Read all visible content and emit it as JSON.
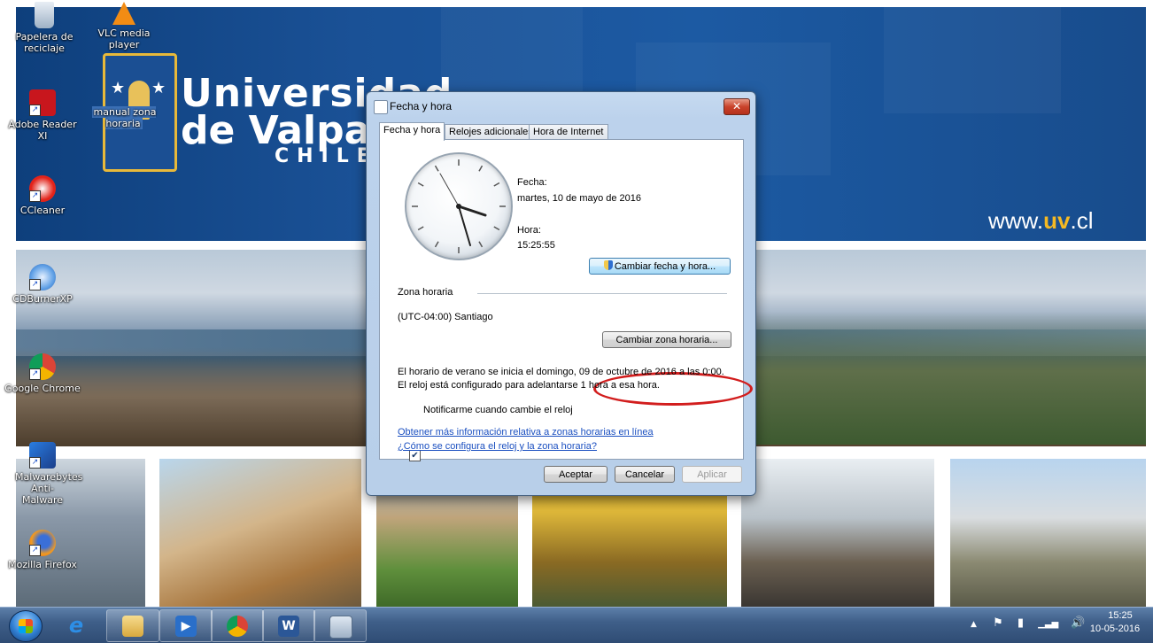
{
  "desktop": {
    "banner": {
      "line1": "Universidad",
      "line2": "de Valparaíso",
      "line3": "CHILE",
      "url_prefix": "www.",
      "url_brand": "uv",
      "url_suffix": ".cl"
    },
    "icons": [
      {
        "label": "Papelera de reciclaje",
        "icon": "recycle-bin-icon"
      },
      {
        "label": "VLC media player",
        "icon": "vlc-icon"
      },
      {
        "label": "Adobe Reader XI",
        "icon": "adobe-reader-icon"
      },
      {
        "label": "manual zona horaria",
        "icon": "document-icon"
      },
      {
        "label": "CCleaner",
        "icon": "ccleaner-icon"
      },
      {
        "label": "CDBurnerXP",
        "icon": "cdburner-icon"
      },
      {
        "label": "Google Chrome",
        "icon": "chrome-icon"
      },
      {
        "label": "Malwarebytes Anti-Malware",
        "icon": "malwarebytes-icon"
      },
      {
        "label": "Mozilla Firefox",
        "icon": "firefox-icon"
      }
    ]
  },
  "dialog": {
    "title": "Fecha y hora",
    "close": "✕",
    "tabs": [
      {
        "label": "Fecha y hora",
        "active": true
      },
      {
        "label": "Relojes adicionales",
        "active": false
      },
      {
        "label": "Hora de Internet",
        "active": false
      }
    ],
    "date_label": "Fecha:",
    "date_value": "martes, 10 de mayo de 2016",
    "time_label": "Hora:",
    "time_value": "15:25:55",
    "change_datetime_button": "Cambiar fecha y hora...",
    "timezone_heading": "Zona horaria",
    "timezone_value": "(UTC-04:00) Santiago",
    "change_timezone_button": "Cambiar zona horaria...",
    "dst_line1": "El horario de verano se inicia el domingo, 09 de octubre de 2016 a las 0:00.",
    "dst_line2": "El reloj está configurado para adelantarse 1 hora a esa hora.",
    "notify_checkbox": {
      "label": "Notificarme cuando cambie el reloj",
      "checked": true
    },
    "link_more_info": "Obtener más información relativa a zonas horarias en línea",
    "link_howto": "¿Cómo se configura el reloj y la zona horaria?",
    "ok_button": "Aceptar",
    "cancel_button": "Cancelar",
    "apply_button": "Aplicar"
  },
  "taskbar": {
    "pinned": [
      "internet-explorer-icon",
      "file-explorer-icon",
      "media-player-icon",
      "chrome-icon",
      "word-icon",
      "calculator-icon"
    ],
    "tray_time": "15:25",
    "tray_date": "10-05-2016"
  },
  "colors": {
    "banner_blue": "#1a5196",
    "accent_gold": "#f5b923",
    "highlight_ring": "#d21d1d",
    "link_blue": "#1a4fc0"
  }
}
